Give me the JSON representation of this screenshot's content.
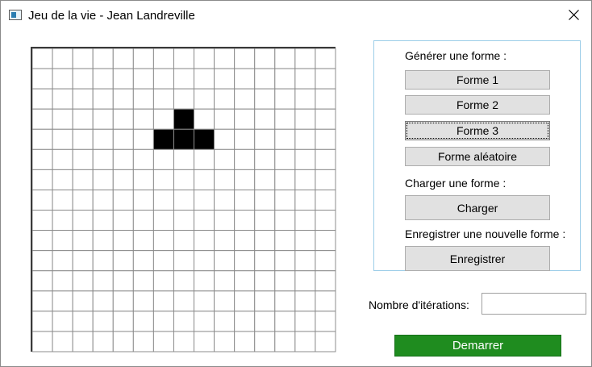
{
  "window": {
    "title": "Jeu de la vie - Jean Landreville"
  },
  "grid": {
    "rows": 15,
    "cols": 15,
    "alive_cells": [
      [
        3,
        7
      ],
      [
        4,
        6
      ],
      [
        4,
        7
      ],
      [
        4,
        8
      ]
    ],
    "alive_color": "#000000",
    "line_color": "#8c8c8c"
  },
  "generate": {
    "label": "Générer une forme :",
    "form1": "Forme 1",
    "form2": "Forme 2",
    "form3": "Forme 3",
    "random": "Forme aléatoire"
  },
  "load": {
    "label": "Charger une forme :",
    "button": "Charger"
  },
  "save": {
    "label": "Enregistrer une nouvelle forme :",
    "button": "Enregistrer"
  },
  "iterations": {
    "label": "Nombre d'itérations:",
    "value": ""
  },
  "start_button": "Demarrer",
  "colors": {
    "start_button": "#1f8c1f",
    "panel_border": "#9ccde8",
    "button_bg": "#e1e1e1"
  }
}
